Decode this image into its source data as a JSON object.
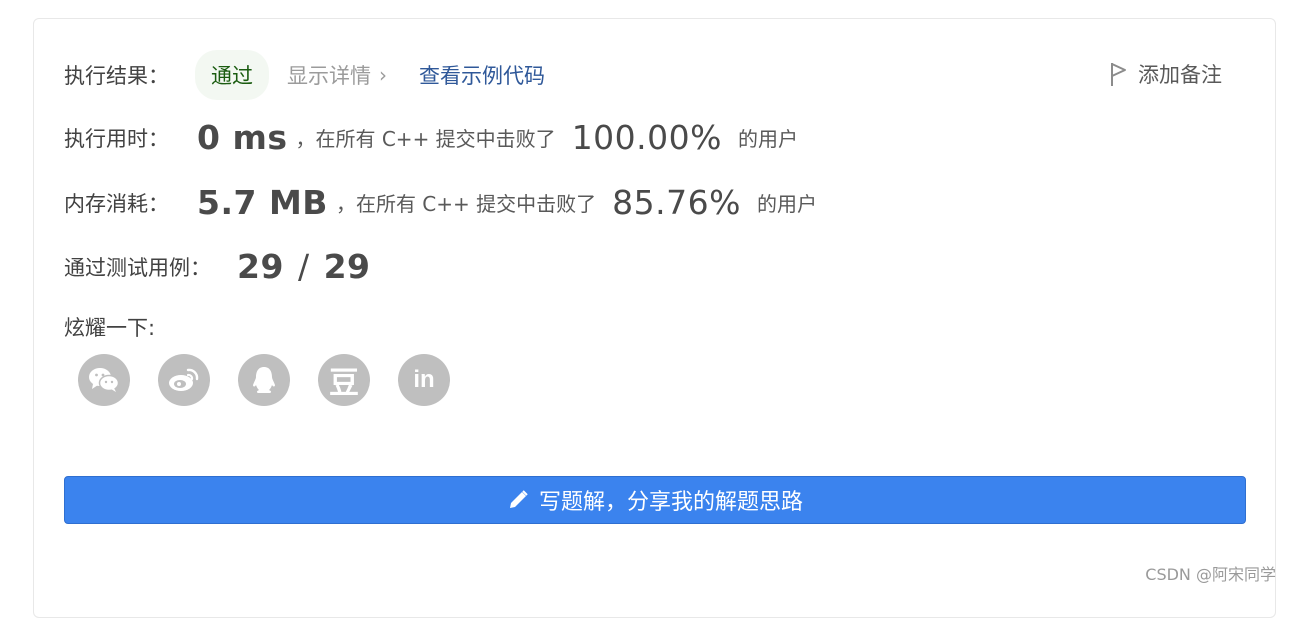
{
  "result": {
    "label": "执行结果：",
    "status": "通过",
    "details": "显示详情",
    "example_link": "查看示例代码",
    "add_note": "添加备注"
  },
  "runtime": {
    "label": "执行用时：",
    "value": "0 ms",
    "mid_text": "，在所有 C++ 提交中击败了",
    "percent": "100.00%",
    "suffix": "的用户"
  },
  "memory": {
    "label": "内存消耗：",
    "value": "5.7 MB",
    "mid_text": "，在所有 C++ 提交中击败了",
    "percent": "85.76%",
    "suffix": "的用户"
  },
  "tests": {
    "label": "通过测试用例：",
    "passed": "29",
    "slash": "/",
    "total": "29"
  },
  "share": {
    "label": "炫耀一下:",
    "icons": [
      "wechat-icon",
      "weibo-icon",
      "qq-icon",
      "douban-icon",
      "linkedin-icon"
    ],
    "douban_glyph": "豆",
    "linkedin_glyph": "in"
  },
  "write_button": {
    "label": "写题解，分享我的解题思路",
    "icon": "pencil-icon"
  },
  "watermark": "CSDN @阿宋同学",
  "colors": {
    "accent": "#3b83ee",
    "success_text": "#1a5c10",
    "success_bg": "#f3f8f2",
    "link": "#2f5899",
    "icon_gray": "#bfbfbf"
  }
}
